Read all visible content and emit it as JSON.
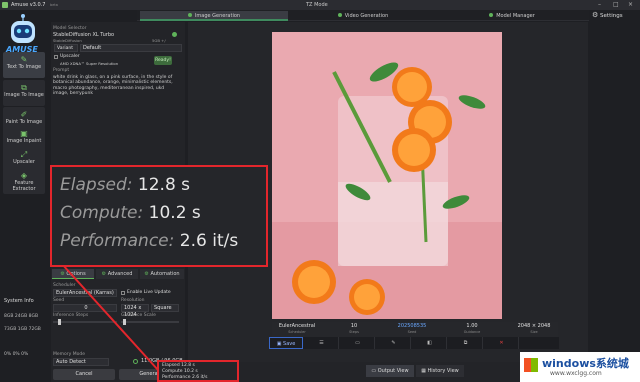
{
  "window": {
    "title": "Amuse v3.0.7",
    "title_suffix": "beta",
    "center_title": "TZ Mode",
    "minimize": "–",
    "maximize": "□",
    "close": "×"
  },
  "tabs": [
    {
      "label": "Image Generation"
    },
    {
      "label": "Video Generation"
    },
    {
      "label": "Model Manager"
    }
  ],
  "settings_label": "Settings",
  "logo_text": "AMUSE",
  "nav": [
    {
      "label": "Text To Image",
      "icon": "text-image-icon"
    },
    {
      "label": "Image To Image",
      "icon": "image-image-icon"
    },
    {
      "label": "Paint To Image",
      "icon": "paint-icon"
    },
    {
      "label": "Image Inpaint",
      "icon": "inpaint-icon"
    },
    {
      "label": "Upscaler",
      "icon": "upscale-icon"
    },
    {
      "label": "Feature Extractor",
      "icon": "feature-icon"
    }
  ],
  "system_info": {
    "label": "System Info",
    "rows": [
      "8GB  24GB  8GB",
      "73GB  1GB  72GB",
      "0%  0%  0%"
    ]
  },
  "panel": {
    "model_selector_label": "Model Selector",
    "model_value": "StableDiffusion XL Turbo",
    "model_sub": "StableDiffusion",
    "model_meta": "5GB  +/",
    "variant_label": "Variant",
    "variant_value": "Default",
    "upscaler_label": "Upscaler",
    "xdna_label": "AMD XDNA™ Super Resolution",
    "ready_label": "Ready!",
    "prompt_label": "Prompt",
    "prompt_text": "white drink in glass, on a pink surface, in the style of botanical abundance, orange, minimalistic elements, macro photography, mediterranean inspired, ukd image, berrypunk",
    "tab_options": "Options",
    "tab_advanced": "Advanced",
    "tab_automation": "Automation",
    "scheduler_label": "Scheduler",
    "scheduler_value": "EulerAncestral (Karras)",
    "live_update_label": "Enable Live Update",
    "seed_label": "Seed",
    "seed_value": "0",
    "resolution_label": "Resolution",
    "resolution_value": "1024 x 1024",
    "square_label": "Square",
    "steps_label": "Inference Steps",
    "guidance_label": "Guidance Scale",
    "memory_label": "Memory Mode",
    "memory_value": "Auto Detect",
    "memory_usage": "11.0GB / 96.0GB",
    "cancel_label": "Cancel",
    "generate_label": "Generate"
  },
  "image_info": [
    {
      "value": "EulerAncestral",
      "key": "Scheduler"
    },
    {
      "value": "10",
      "key": "Steps"
    },
    {
      "value": "202508535",
      "key": "Seed"
    },
    {
      "value": "1.00",
      "key": "Guidance"
    },
    {
      "value": "2048 × 2048",
      "key": "Size"
    }
  ],
  "toolbar": {
    "save_label": "Save"
  },
  "overlay": {
    "elapsed_label": "Elapsed:",
    "elapsed_value": "12.8 s",
    "compute_label": "Compute:",
    "compute_value": "10.2 s",
    "perf_label": "Performance:",
    "perf_value": "2.6 it/s"
  },
  "mini": {
    "elapsed": "Elapsed 12.8 s",
    "compute": "Compute 10.2 s",
    "performance": "Performance 2.6 it/s"
  },
  "bottom": {
    "output_view": "Output View",
    "history_view": "History View"
  },
  "watermark": {
    "main": "windows系统城",
    "sub": "www.wxclgg.com"
  },
  "colors": {
    "accent": "#5fb35a",
    "alert": "#e3262c",
    "bg": "#1e1f23"
  }
}
